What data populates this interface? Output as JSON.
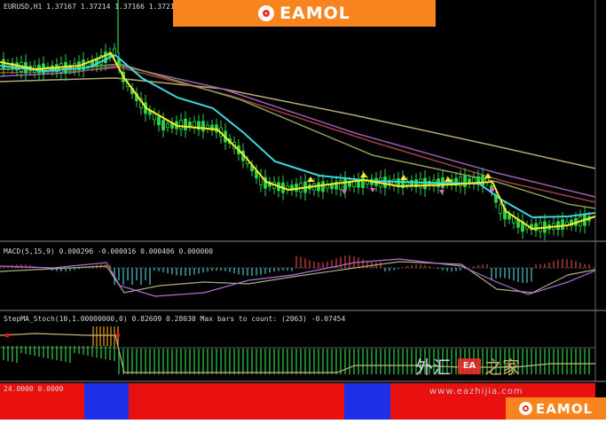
{
  "brand": {
    "logo_text": "EAMOL",
    "color": "#f7841f"
  },
  "main_panel": {
    "symbol_line": "EURUSD,H1 1.37167 1.37214 1.37166 1.37211"
  },
  "macd_panel": {
    "info_line": "MACD(5,15,9) 0.000296 -0.000016 0.000406 0.000000"
  },
  "stoch_panel": {
    "info_line": "StepMA_Stoch(10,1.00000000,0) 0.82609 0.28030 Max bars to count: (2063) -0.07454"
  },
  "bar_panel": {
    "value_label": "24.0000 0.0000",
    "segments": [
      {
        "color": "#e8110f"
      },
      {
        "color": "#1f2fe8"
      },
      {
        "color": "#e8110f"
      },
      {
        "color": "#1f2fe8"
      },
      {
        "color": "#e8110f"
      }
    ]
  },
  "watermark": {
    "cn": "外汇",
    "badge": "EA",
    "cn2": "之家",
    "url": "www.eazhijia.com"
  },
  "colors": {
    "bg": "#000000",
    "candle": "#2bd54a",
    "cyan_ma": "#3fd6e0",
    "yellow_ma": "#ffe82c",
    "olive_ma": "#8d9a55",
    "red_ma": "#a04040",
    "purple_ma": "#9a5fb0",
    "tan_ma": "#b9a774"
  }
}
